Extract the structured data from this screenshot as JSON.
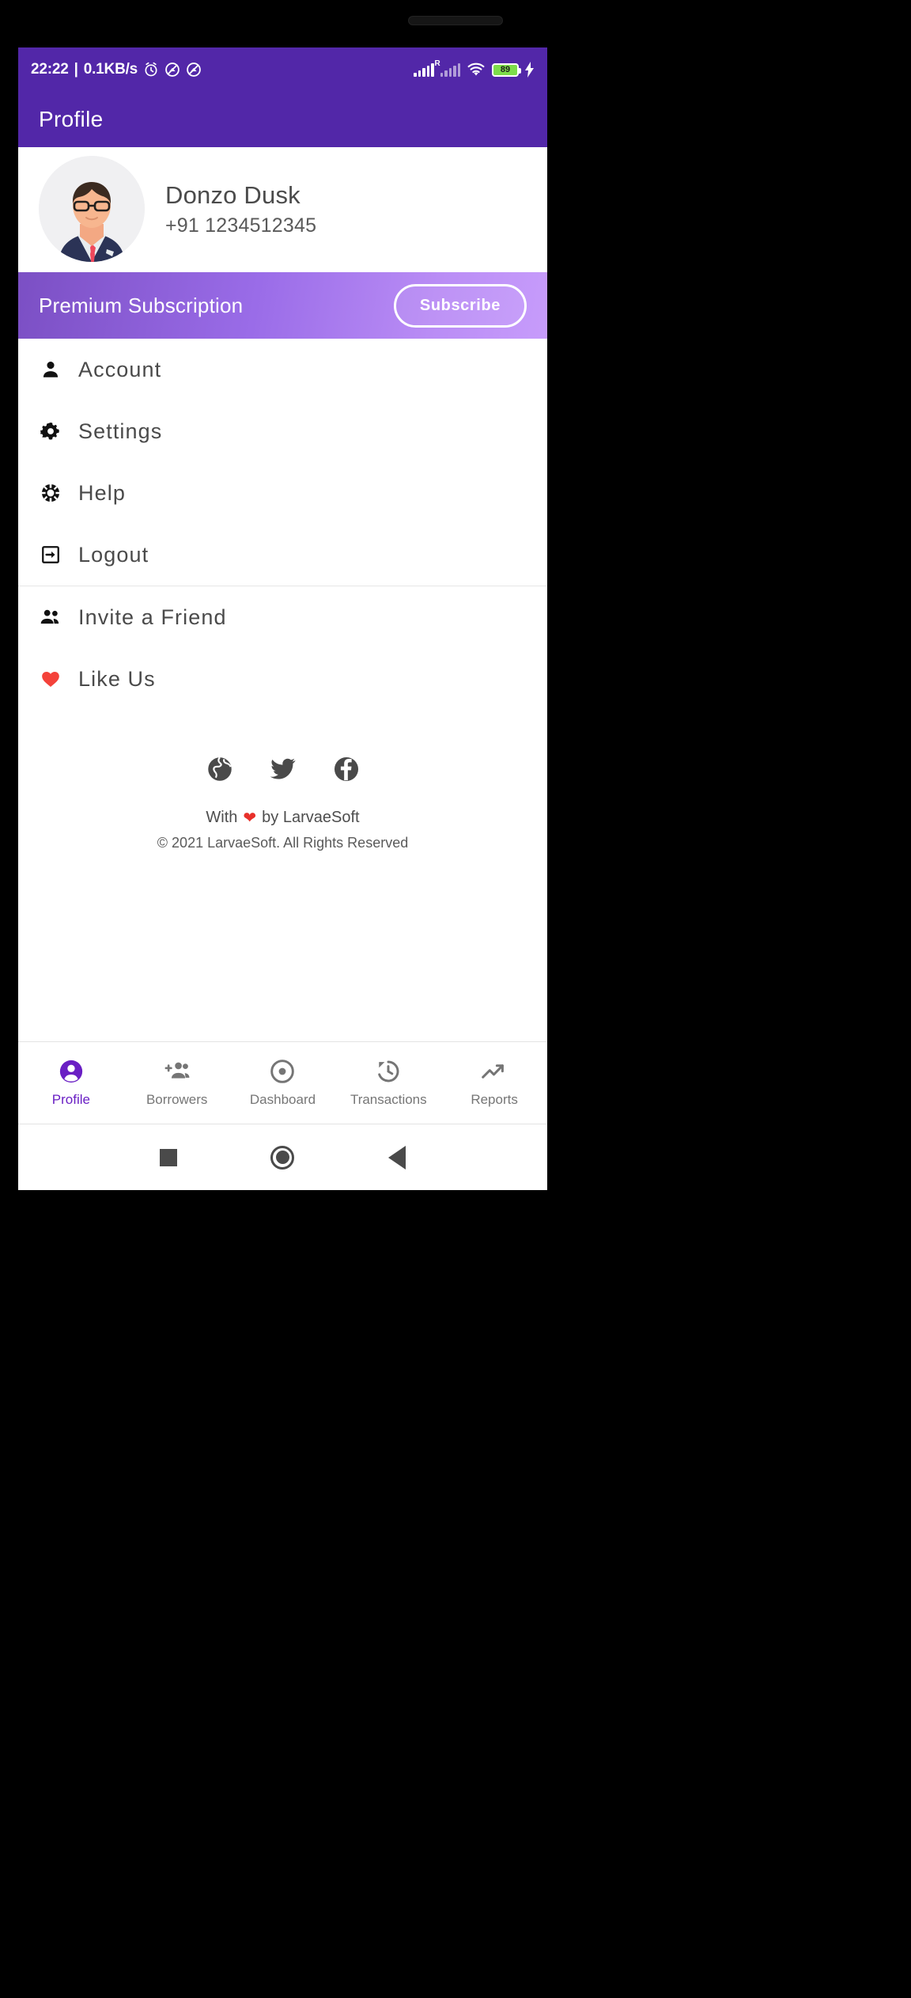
{
  "status_bar": {
    "time": "22:22",
    "separator": "|",
    "network_speed": "0.1KB/s",
    "icons_left": [
      "alarm-icon",
      "dnd-icon",
      "dnd-icon"
    ],
    "icons_right": [
      "signal-bars-icon",
      "signal-bars-sim2-icon",
      "wifi-icon",
      "battery-icon"
    ],
    "sim2_label": "R",
    "battery_percent": "89",
    "charging": true,
    "background_color": "#5227a8"
  },
  "app_bar": {
    "title": "Profile",
    "background_color": "#5227a8"
  },
  "profile": {
    "avatar": "user-avatar-businessman",
    "name": "Donzo Dusk",
    "phone": "+91 1234512345"
  },
  "premium": {
    "label": "Premium Subscription",
    "button_label": "Subscribe",
    "gradient_from": "#7b4fc4",
    "gradient_to": "#c79cfb"
  },
  "menu_groups": [
    {
      "items": [
        {
          "label": "Account",
          "icon": "person-icon"
        },
        {
          "label": "Settings",
          "icon": "gear-icon"
        },
        {
          "label": "Help",
          "icon": "lifebuoy-icon"
        },
        {
          "label": "Logout",
          "icon": "logout-icon"
        }
      ]
    },
    {
      "items": [
        {
          "label": "Invite a Friend",
          "icon": "people-icon"
        },
        {
          "label": "Like Us",
          "icon": "heart-icon"
        }
      ]
    }
  ],
  "footer": {
    "social": [
      {
        "name": "website-icon"
      },
      {
        "name": "twitter-icon"
      },
      {
        "name": "facebook-icon"
      }
    ],
    "credit_prefix": "With",
    "credit_heart": "❤",
    "credit_suffix": "by LarvaeSoft",
    "copyright": "© 2021 LarvaeSoft. All Rights Reserved"
  },
  "bottom_nav": {
    "active_color": "#6a1fc4",
    "items": [
      {
        "label": "Profile",
        "icon": "account-circle-icon",
        "active": true
      },
      {
        "label": "Borrowers",
        "icon": "person-add-icon",
        "active": false
      },
      {
        "label": "Dashboard",
        "icon": "dashboard-dot-icon",
        "active": false
      },
      {
        "label": "Transactions",
        "icon": "history-icon",
        "active": false
      },
      {
        "label": "Reports",
        "icon": "trending-up-icon",
        "active": false
      }
    ]
  },
  "android_nav": {
    "buttons": [
      {
        "name": "recents-button"
      },
      {
        "name": "home-button"
      },
      {
        "name": "back-button"
      }
    ]
  }
}
